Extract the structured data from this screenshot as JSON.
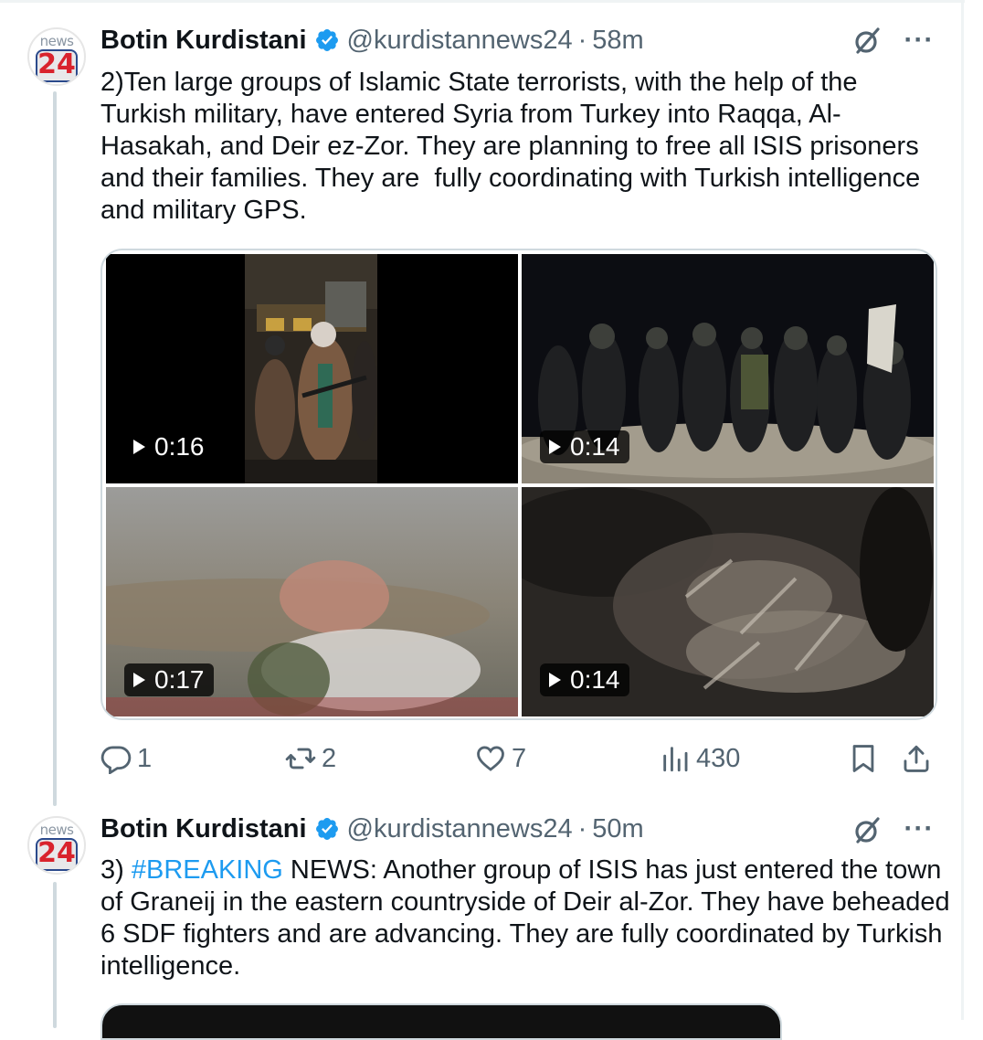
{
  "tweets": [
    {
      "author_name": "Botin Kurdistani",
      "handle": "@kurdistannews24",
      "separator": "·",
      "time": "58m",
      "avatar": {
        "top_text": "news",
        "number": "24"
      },
      "text": "2)Ten large groups of Islamic State terrorists, with the help of the Turkish military, have entered Syria from Turkey into Raqqa, Al-Hasakah, and Deir ez-Zor. They are planning to free all ISIS prisoners and their families. They are  fully coordinating with Turkish intelligence and military GPS.",
      "media": [
        {
          "duration": "0:16"
        },
        {
          "duration": "0:14"
        },
        {
          "duration": "0:17"
        },
        {
          "duration": "0:14"
        }
      ],
      "actions": {
        "replies": "1",
        "reposts": "2",
        "likes": "7",
        "views": "430"
      }
    },
    {
      "author_name": "Botin Kurdistani",
      "handle": "@kurdistannews24",
      "separator": "·",
      "time": "50m",
      "avatar": {
        "top_text": "news",
        "number": "24"
      },
      "text_prefix": "3) ",
      "hashtag": "#BREAKING",
      "text_rest": " NEWS: Another group of ISIS has just entered the town of Graneij in the eastern countryside of Deir al-Zor. They have beheaded  6 SDF fighters and are advancing. They are fully coordinated by Turkish intelligence."
    }
  ],
  "icons": {
    "verified": "verified-badge-icon",
    "grok": "grok-icon",
    "more": "more-icon",
    "reply": "reply-icon",
    "repost": "repost-icon",
    "like": "heart-icon",
    "views": "views-icon",
    "bookmark": "bookmark-icon",
    "share": "share-icon"
  },
  "colors": {
    "accent": "#1d9bf0",
    "text": "#0f1419",
    "muted": "#536471",
    "border": "#cfd9de",
    "brand_red": "#d9232d"
  },
  "more_glyph": "···"
}
